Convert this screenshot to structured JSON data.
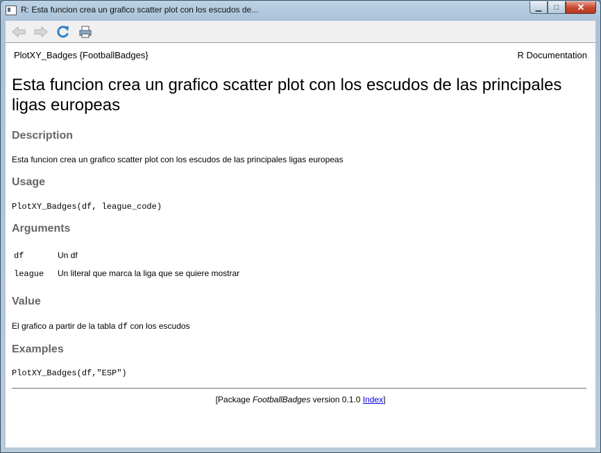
{
  "window": {
    "title": "R: Esta funcion crea un grafico scatter plot con los escudos de...",
    "controls": {
      "minimize": "▁",
      "maximize": "□",
      "close": "✕"
    }
  },
  "toolbar": {
    "buttons": [
      "back-arrow-icon",
      "forward-arrow-icon",
      "refresh-icon",
      "print-icon"
    ]
  },
  "doc": {
    "header_left": "PlotXY_Badges {FootballBadges}",
    "header_right": "R Documentation",
    "title": "Esta funcion crea un grafico scatter plot con los escudos de las principales ligas europeas",
    "description_heading": "Description",
    "description_text": "Esta funcion crea un grafico scatter plot con los escudos de las principales ligas europeas",
    "usage_heading": "Usage",
    "usage_code": "PlotXY_Badges(df, league_code)",
    "arguments_heading": "Arguments",
    "arguments": [
      {
        "name": "df",
        "desc": "Un df"
      },
      {
        "name": "league",
        "desc": "Un literal que marca la liga que se quiere mostrar"
      }
    ],
    "value_heading": "Value",
    "value_text_before": "El grafico a partir de la tabla ",
    "value_code": "df",
    "value_text_after": " con los escudos",
    "examples_heading": "Examples",
    "examples_code": "PlotXY_Badges(df,\"ESP\")",
    "footer_prefix": "[Package ",
    "footer_package": "FootballBadges",
    "footer_version": " version 0.1.0 ",
    "footer_link": "Index",
    "footer_suffix": "]"
  },
  "colors": {
    "heading": "#666666",
    "link": "#0000ee",
    "close_button": "#c8452f"
  }
}
